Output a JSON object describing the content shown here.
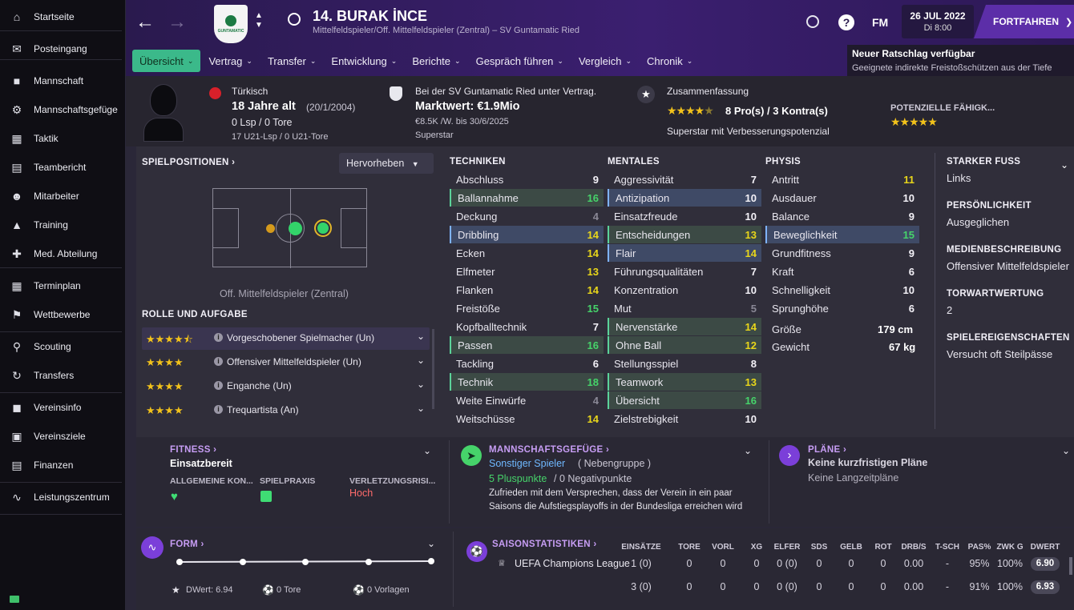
{
  "sidebar": {
    "items": [
      {
        "icon": "home-icon",
        "label": "Startseite"
      },
      {
        "icon": "inbox-icon",
        "label": "Posteingang"
      },
      {
        "icon": "shirt-icon",
        "label": "Mannschaft"
      },
      {
        "icon": "dynamics-icon",
        "label": "Mannschaftsgefüge"
      },
      {
        "icon": "tactics-icon",
        "label": "Taktik"
      },
      {
        "icon": "report-icon",
        "label": "Teambericht"
      },
      {
        "icon": "staff-icon",
        "label": "Mitarbeiter"
      },
      {
        "icon": "training-icon",
        "label": "Training"
      },
      {
        "icon": "medical-icon",
        "label": "Med. Abteilung"
      },
      {
        "icon": "calendar-icon",
        "label": "Terminplan"
      },
      {
        "icon": "trophy-icon",
        "label": "Wettbewerbe"
      },
      {
        "icon": "scouting-icon",
        "label": "Scouting"
      },
      {
        "icon": "transfers-icon",
        "label": "Transfers"
      },
      {
        "icon": "club-info-icon",
        "label": "Vereinsinfo"
      },
      {
        "icon": "club-vision-icon",
        "label": "Vereinsziele"
      },
      {
        "icon": "finances-icon",
        "label": "Finanzen"
      },
      {
        "icon": "performance-icon",
        "label": "Leistungszentrum"
      }
    ]
  },
  "header": {
    "player_name": "14. BURAK İNCE",
    "subtitle": "Mittelfeldspieler/Off. Mittelfeldspieler (Zentral) – SV Guntamatic Ried",
    "date": "26 JUL 2022",
    "time": "Di 8:00",
    "continue": "FORTFAHREN",
    "fm": "FM",
    "club_badge_text": "GUNTAMATIC",
    "advice_title": "Neuer Ratschlag verfügbar",
    "advice_text": "Geeignete indirekte Freistoßschützen aus der Tiefe"
  },
  "tabs": [
    "Übersicht",
    "Vertrag",
    "Transfer",
    "Entwicklung",
    "Berichte",
    "Gespräch führen",
    "Vergleich",
    "Chronik"
  ],
  "profile": {
    "nationality": "Türkisch",
    "age": "18 Jahre alt",
    "dob": "(20/1/2004)",
    "league": "0 Lsp / 0 Tore",
    "u21": "17 U21-Lsp / 0 U21-Tore"
  },
  "contract": {
    "club_text": "Bei der SV Guntamatic Ried unter Vertrag.",
    "value": "Marktwert: €1.9Mio",
    "wage": "€8.5K /W. bis 30/6/2025",
    "status": "Superstar"
  },
  "summary": {
    "title": "Zusammenfassung",
    "pros_cons": "8 Pro(s) / 3 Kontra(s)",
    "text": "Superstar mit Verbesserungspotenzial",
    "potential_label": "POTENZIELLE FÄHIGK...",
    "rating_stars": 4.5,
    "potential_stars": 5
  },
  "positions": {
    "title": "SPIELPOSITIONEN",
    "highlight": "Hervorheben",
    "position_label": "Off. Mittelfeldspieler (Zentral)",
    "roles_title": "ROLLE UND AUFGABE",
    "roles": [
      {
        "stars": 4.5,
        "name": "Vorgeschobener Spielmacher (Un)"
      },
      {
        "stars": 4,
        "name": "Offensiver Mittelfeldspieler (Un)"
      },
      {
        "stars": 4,
        "name": "Enganche (Un)"
      },
      {
        "stars": 4,
        "name": "Trequartista (An)"
      }
    ]
  },
  "attributes": {
    "technical_title": "TECHNIKEN",
    "mental_title": "MENTALES",
    "physical_title": "PHYSIS",
    "technical": [
      [
        "Abschluss",
        "9"
      ],
      [
        "Ballannahme",
        "16"
      ],
      [
        "Deckung",
        "4"
      ],
      [
        "Dribbling",
        "14"
      ],
      [
        "Ecken",
        "14"
      ],
      [
        "Elfmeter",
        "13"
      ],
      [
        "Flanken",
        "14"
      ],
      [
        "Freistöße",
        "15"
      ],
      [
        "Kopfballtechnik",
        "7"
      ],
      [
        "Passen",
        "16"
      ],
      [
        "Tackling",
        "6"
      ],
      [
        "Technik",
        "18"
      ],
      [
        "Weite Einwürfe",
        "4"
      ],
      [
        "Weitschüsse",
        "14"
      ]
    ],
    "mental": [
      [
        "Aggressivität",
        "7"
      ],
      [
        "Antizipation",
        "10"
      ],
      [
        "Einsatzfreude",
        "10"
      ],
      [
        "Entscheidungen",
        "13"
      ],
      [
        "Flair",
        "14"
      ],
      [
        "Führungsqualitäten",
        "7"
      ],
      [
        "Konzentration",
        "10"
      ],
      [
        "Mut",
        "5"
      ],
      [
        "Nervenstärke",
        "14"
      ],
      [
        "Ohne Ball",
        "12"
      ],
      [
        "Stellungsspiel",
        "8"
      ],
      [
        "Teamwork",
        "13"
      ],
      [
        "Übersicht",
        "16"
      ],
      [
        "Zielstrebigkeit",
        "10"
      ]
    ],
    "physical": [
      [
        "Antritt",
        "11"
      ],
      [
        "Ausdauer",
        "10"
      ],
      [
        "Balance",
        "9"
      ],
      [
        "Beweglichkeit",
        "15"
      ],
      [
        "Grundfitness",
        "9"
      ],
      [
        "Kraft",
        "6"
      ],
      [
        "Schnelligkeit",
        "10"
      ],
      [
        "Sprunghöhe",
        "6"
      ]
    ],
    "height_label": "Größe",
    "height": "179 cm",
    "weight_label": "Gewicht",
    "weight": "67 kg"
  },
  "info": [
    {
      "label": "STARKER FUSS",
      "value": "Links"
    },
    {
      "label": "PERSÖNLICHKEIT",
      "value": "Ausgeglichen"
    },
    {
      "label": "MEDIENBESCHREIBUNG",
      "value": "Offensiver Mittelfeldspieler"
    },
    {
      "label": "TORWARTWERTUNG",
      "value": "2"
    },
    {
      "label": "SPIELEREIGENSCHAFTEN",
      "value": "Versucht oft Steilpässe"
    }
  ],
  "fitness": {
    "title": "FITNESS",
    "status": "Einsatzbereit",
    "c1": "ALLGEMEINE KON...",
    "c2": "SPIELPRAXIS",
    "c3": "VERLETZUNGSRISI...",
    "risk": "Hoch"
  },
  "dynamics": {
    "title": "MANNSCHAFTSGEFÜGE",
    "role": "Sonstiger Spieler",
    "group": "( Nebengruppe )",
    "plus": "5 Pluspunkte",
    "minus": "/ 0 Negativpunkte",
    "text1": "Zufrieden mit dem Versprechen, dass der Verein in ein paar",
    "text2": "Saisons die Aufstiegsplayoffs in der Bundesliga erreichen wird"
  },
  "plans": {
    "title": "PLÄNE",
    "short": "Keine kurzfristigen Pläne",
    "long": "Keine Langzeitpläne"
  },
  "form": {
    "title": "FORM",
    "rating": "DWert: 6.94",
    "goals": "0 Tore",
    "assists": "0 Vorlagen"
  },
  "season": {
    "title": "SAISONSTATISTIKEN",
    "cols": [
      "EINSÄTZE",
      "TORE",
      "VORL",
      "XG",
      "ELFER",
      "SDS",
      "GELB",
      "ROT",
      "DRB/S",
      "T-SCH",
      "PAS%",
      "ZWK G",
      "DWERT"
    ],
    "rows": [
      {
        "comp": "UEFA Champions League",
        "vals": [
          "1 (0)",
          "0",
          "0",
          "0",
          "0 (0)",
          "0",
          "0",
          "0",
          "0.00",
          "-",
          "95%",
          "100%",
          "6.90"
        ]
      },
      {
        "comp": "",
        "vals": [
          "3 (0)",
          "0",
          "0",
          "0",
          "0 (0)",
          "0",
          "0",
          "0",
          "0.00",
          "-",
          "91%",
          "100%",
          "6.93"
        ]
      }
    ]
  }
}
